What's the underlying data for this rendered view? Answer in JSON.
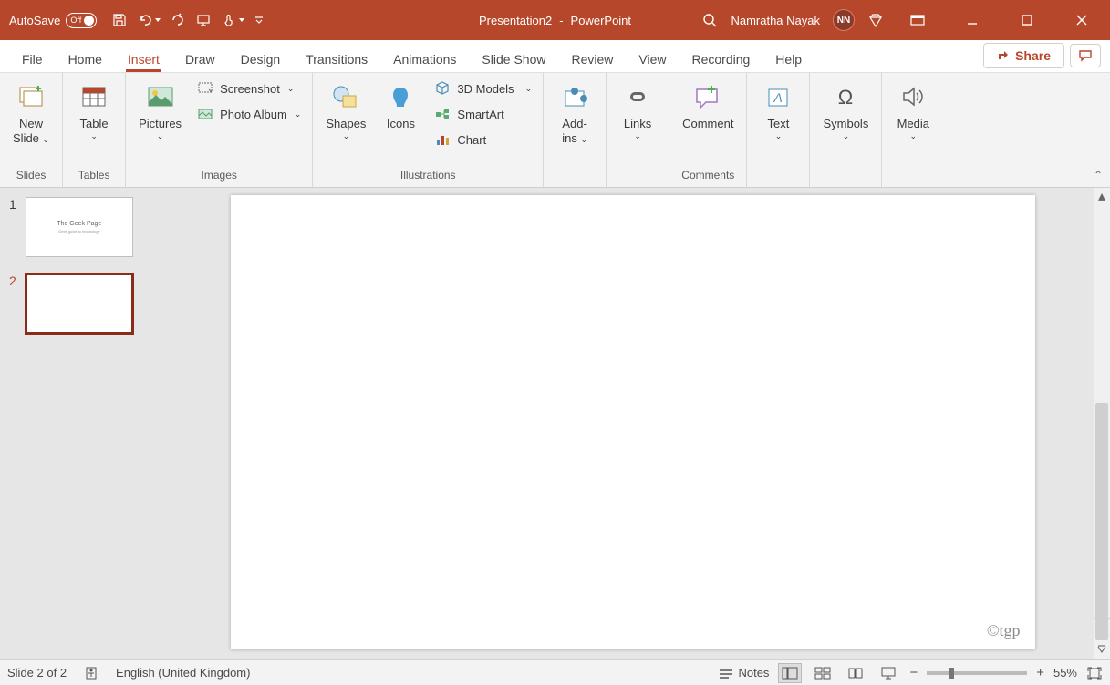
{
  "titlebar": {
    "autosave_label": "AutoSave",
    "autosave_state": "Off",
    "doc_name": "Presentation2",
    "app_name": "PowerPoint",
    "user_name": "Namratha Nayak",
    "user_initials": "NN"
  },
  "tabs": {
    "items": [
      "File",
      "Home",
      "Insert",
      "Draw",
      "Design",
      "Transitions",
      "Animations",
      "Slide Show",
      "Review",
      "View",
      "Recording",
      "Help"
    ],
    "active_index": 2,
    "share_label": "Share"
  },
  "ribbon": {
    "slides": {
      "group_label": "Slides",
      "new_slide_line1": "New",
      "new_slide_line2": "Slide"
    },
    "tables": {
      "group_label": "Tables",
      "table_label": "Table"
    },
    "images": {
      "group_label": "Images",
      "pictures_label": "Pictures",
      "screenshot_label": "Screenshot",
      "photo_album_label": "Photo Album"
    },
    "illustrations": {
      "group_label": "Illustrations",
      "shapes_label": "Shapes",
      "icons_label": "Icons",
      "models_label": "3D Models",
      "smartart_label": "SmartArt",
      "chart_label": "Chart"
    },
    "addins": {
      "label_line1": "Add-",
      "label_line2": "ins"
    },
    "links": {
      "label": "Links"
    },
    "comments": {
      "group_label": "Comments",
      "comment_label": "Comment"
    },
    "text": {
      "label": "Text"
    },
    "symbols": {
      "label": "Symbols"
    },
    "media": {
      "label": "Media"
    }
  },
  "thumbnails": {
    "items": [
      {
        "num": "1",
        "title": "The Geek Page",
        "subtitle": "Geek guide to technology",
        "active": false
      },
      {
        "num": "2",
        "title": "",
        "subtitle": "",
        "active": true
      }
    ]
  },
  "canvas": {
    "watermark": "©tgp"
  },
  "statusbar": {
    "slide_indicator": "Slide 2 of 2",
    "language": "English (United Kingdom)",
    "notes_label": "Notes",
    "zoom_label": "55%"
  }
}
